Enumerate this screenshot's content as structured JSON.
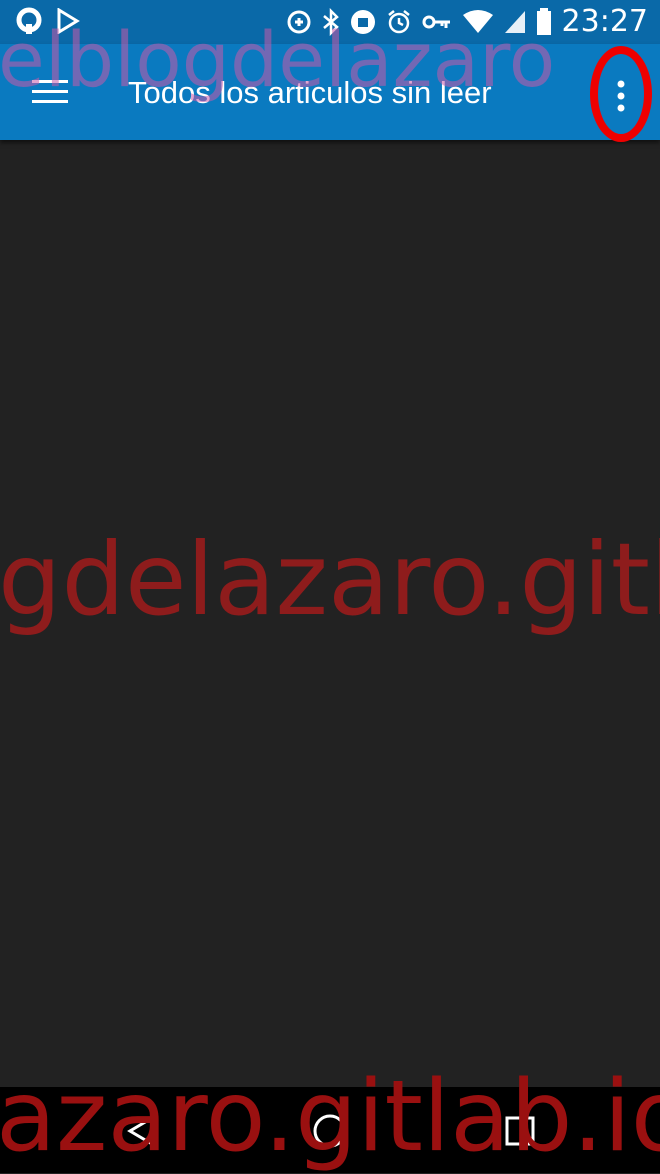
{
  "status_bar": {
    "time": "23:27",
    "left_icons": [
      "sync-icon",
      "play-store-icon"
    ],
    "right_icons": [
      "data-saver-icon",
      "bluetooth-icon",
      "profile-icon",
      "alarm-icon",
      "vpn-key-icon",
      "wifi-icon",
      "signal-icon",
      "battery-icon"
    ]
  },
  "app_bar": {
    "menu_icon": "hamburger-menu-icon",
    "title": "Todos los articulos sin leer",
    "overflow_icon": "more-vert-icon"
  },
  "watermark": {
    "top": "elblogdelazaro",
    "middle": "gdelazaro.gitl",
    "bottom": "azaro.gitlab.io"
  },
  "nav_bar": {
    "buttons": [
      "back-icon",
      "home-icon",
      "recents-icon"
    ]
  },
  "colors": {
    "status_bar": "#0a69a8",
    "app_bar": "#0a7ac0",
    "content_bg": "#222222",
    "highlight": "#ee0000"
  }
}
